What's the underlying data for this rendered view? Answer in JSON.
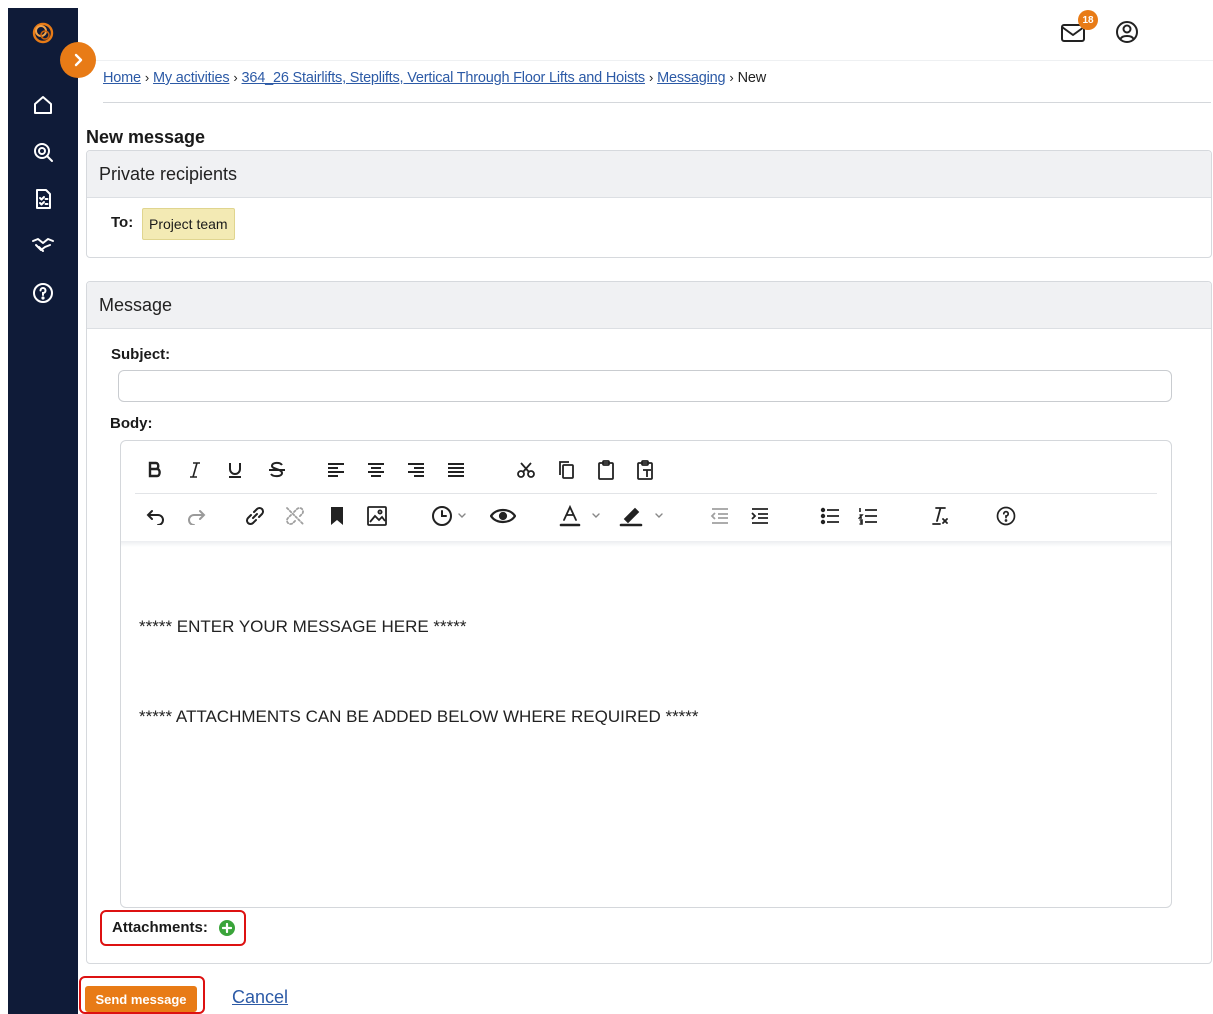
{
  "colors": {
    "sidebar_bg": "#0f1b38",
    "accent_orange": "#e87b16",
    "link_blue": "#2c5aa6",
    "chip_bg": "#f3eab4",
    "highlight_red": "#dd1111",
    "add_green": "#3aa43a"
  },
  "sidebar": {
    "icons": [
      "logo-icon",
      "home-icon",
      "search-icon",
      "checklist-icon",
      "handshake-icon",
      "help-icon"
    ],
    "expander_icon": "chevron-right-icon"
  },
  "header": {
    "mail_badge": "18",
    "mail_icon": "mail-icon",
    "user_icon": "user-icon"
  },
  "breadcrumb": {
    "items": [
      "Home",
      "My activities",
      "364_26 Stairlifts, Steplifts, Vertical Through Floor Lifts and Hoists",
      "Messaging"
    ],
    "current": "New",
    "separator": "›"
  },
  "page": {
    "title": "New message"
  },
  "recipients_panel": {
    "title": "Private recipients",
    "to_label": "To:",
    "recipients": [
      "Project team"
    ]
  },
  "message_panel": {
    "title": "Message",
    "subject_label": "Subject:",
    "subject_value": "",
    "body_label": "Body:",
    "body_lines": [
      "***** ENTER YOUR MESSAGE HERE *****",
      "***** ATTACHMENTS CAN BE ADDED BELOW WHERE REQUIRED *****"
    ],
    "toolbar_row1": [
      "bold-icon",
      "italic-icon",
      "underline-icon",
      "strikethrough-icon",
      "align-left-icon",
      "align-center-icon",
      "align-right-icon",
      "align-justify-icon",
      "cut-icon",
      "copy-icon",
      "paste-icon",
      "paste-text-icon"
    ],
    "toolbar_row2": [
      "undo-icon",
      "redo-icon",
      "link-icon",
      "unlink-icon",
      "bookmark-icon",
      "image-icon",
      "clock-icon",
      "preview-icon",
      "text-color-icon",
      "highlight-color-icon",
      "outdent-icon",
      "indent-icon",
      "bullet-list-icon",
      "numbered-list-icon",
      "clear-format-icon",
      "help-icon"
    ],
    "attachments_label": "Attachments:"
  },
  "actions": {
    "send_label": "Send message",
    "cancel_label": "Cancel"
  }
}
